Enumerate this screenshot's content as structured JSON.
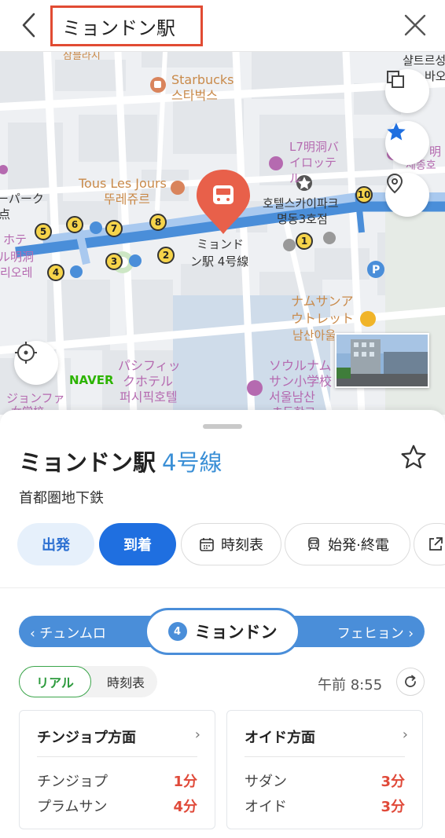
{
  "topbar": {
    "search_text": "ミョンドン駅"
  },
  "map": {
    "labels": {
      "starbucks_en": "Starbucks",
      "starbucks_ko": "스타벅스",
      "tous_en": "Tous Les Jours",
      "tous_ko": "뚜레쥬르",
      "l7_line1": "L7明洞バ",
      "l7_line2": "イロッテ",
      "l7_line3": "ル",
      "skypark_line1": "호텔스카이파크",
      "skypark_line2": "명동3호점",
      "station_line1": "ミョンド",
      "station_line2": "ン駅 4号線",
      "namsan_line1": "ナムサンア",
      "namsan_line2": "ウトレット",
      "namsan_line3": "남산아울",
      "pacific_line1": "パシフィッ",
      "pacific_line2": "クホテル",
      "pacific_line3": "퍼시픽호텔",
      "seoul_line1": "ソウルナム",
      "seoul_line2": "サン小学校",
      "seoul_line3": "서울남산",
      "seoul_line4": "초등학교",
      "left_line1": "ジョンファ",
      "left_line2": "女学校",
      "left_park1": "ーパーク",
      "left_park2": "点",
      "left_hotel1": "ホテ",
      "left_hotel2": "ル明洞",
      "left_hotel3": "리오레",
      "right_top1": "샬트르성",
      "right_top2": "바오로",
      "right_school1": "明",
      "right_school2": "세종호",
      "top_left_cut": "삼블라시",
      "naver": "NAVER"
    },
    "exit_numbers": [
      "1",
      "2",
      "3",
      "4",
      "5",
      "6",
      "7",
      "8",
      "10"
    ]
  },
  "sheet": {
    "station_name": "ミョンドン駅",
    "line_name": "4号線",
    "operator": "首都圏地下鉄",
    "actions": {
      "depart": "出発",
      "arrive": "到着",
      "timetable": "時刻表",
      "first_last": "始発·終電"
    },
    "line_bar": {
      "prev": "チュンムロ",
      "next": "フェヒョン",
      "current": "ミョンドン",
      "line_number": "4"
    },
    "toggle": {
      "realtime": "リアル",
      "timetable": "時刻表"
    },
    "current_time": "午前 8:55",
    "directions": [
      {
        "title": "チンジョプ方面",
        "arrivals": [
          {
            "station": "チンジョプ",
            "minutes": "1分"
          },
          {
            "station": "プラムサン",
            "minutes": "4分"
          }
        ]
      },
      {
        "title": "オイド方面",
        "arrivals": [
          {
            "station": "サダン",
            "minutes": "3分"
          },
          {
            "station": "オイド",
            "minutes": "3分"
          }
        ]
      }
    ]
  },
  "colors": {
    "accent_blue": "#1f6fe0",
    "line4_blue": "#4a8ed9",
    "arrival_red": "#e04a3a",
    "realtime_green": "#2e9b3e",
    "search_highlight": "#e14b33",
    "marker_red": "#e8604a"
  },
  "icons": {
    "back": "chevron-left-icon",
    "close": "close-icon",
    "layers": "layers-icon",
    "favorite": "star-icon",
    "location_pin": "location-pin-icon",
    "current_location": "crosshair-icon",
    "train": "train-icon",
    "refresh": "refresh-icon",
    "share": "share-icon"
  }
}
